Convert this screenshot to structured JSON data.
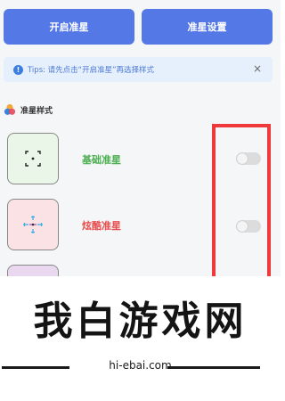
{
  "toolbar": {
    "enable_label": "开启准星",
    "settings_label": "准星设置"
  },
  "tips": {
    "text": "Tips: 请先点击“开启准星”再选择样式",
    "close": "×"
  },
  "section": {
    "title": "准星样式"
  },
  "styles": [
    {
      "label": "基础准星",
      "color": "#4caf50",
      "thumb_bg": "#eaf6e8",
      "enabled": false
    },
    {
      "label": "炫酷准星",
      "color": "#e84d4d",
      "thumb_bg": "#fbe2e5",
      "enabled": false
    },
    {
      "label": "",
      "thumb_bg": "#ead8f0"
    }
  ],
  "accents": {
    "primary_button": "#5478e6",
    "highlight_box": "#f0393a"
  },
  "watermark": {
    "title": "我白游戏网",
    "url": "hi-ebai.com"
  }
}
